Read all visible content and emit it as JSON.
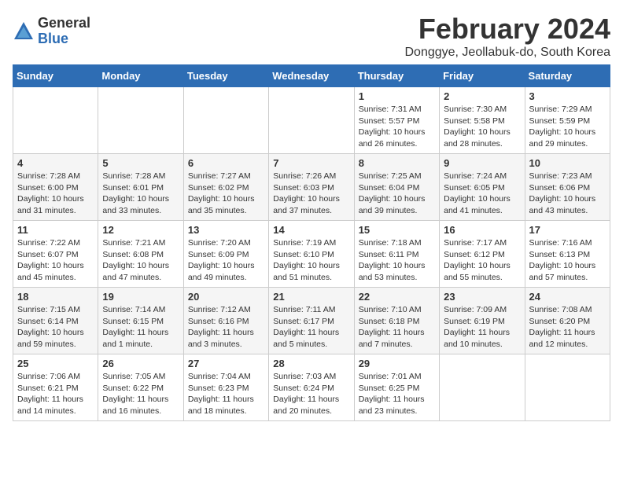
{
  "logo": {
    "general": "General",
    "blue": "Blue"
  },
  "title": "February 2024",
  "location": "Donggye, Jeollabuk-do, South Korea",
  "days_of_week": [
    "Sunday",
    "Monday",
    "Tuesday",
    "Wednesday",
    "Thursday",
    "Friday",
    "Saturday"
  ],
  "weeks": [
    [
      {
        "day": "",
        "info": ""
      },
      {
        "day": "",
        "info": ""
      },
      {
        "day": "",
        "info": ""
      },
      {
        "day": "",
        "info": ""
      },
      {
        "day": "1",
        "info": "Sunrise: 7:31 AM\nSunset: 5:57 PM\nDaylight: 10 hours\nand 26 minutes."
      },
      {
        "day": "2",
        "info": "Sunrise: 7:30 AM\nSunset: 5:58 PM\nDaylight: 10 hours\nand 28 minutes."
      },
      {
        "day": "3",
        "info": "Sunrise: 7:29 AM\nSunset: 5:59 PM\nDaylight: 10 hours\nand 29 minutes."
      }
    ],
    [
      {
        "day": "4",
        "info": "Sunrise: 7:28 AM\nSunset: 6:00 PM\nDaylight: 10 hours\nand 31 minutes."
      },
      {
        "day": "5",
        "info": "Sunrise: 7:28 AM\nSunset: 6:01 PM\nDaylight: 10 hours\nand 33 minutes."
      },
      {
        "day": "6",
        "info": "Sunrise: 7:27 AM\nSunset: 6:02 PM\nDaylight: 10 hours\nand 35 minutes."
      },
      {
        "day": "7",
        "info": "Sunrise: 7:26 AM\nSunset: 6:03 PM\nDaylight: 10 hours\nand 37 minutes."
      },
      {
        "day": "8",
        "info": "Sunrise: 7:25 AM\nSunset: 6:04 PM\nDaylight: 10 hours\nand 39 minutes."
      },
      {
        "day": "9",
        "info": "Sunrise: 7:24 AM\nSunset: 6:05 PM\nDaylight: 10 hours\nand 41 minutes."
      },
      {
        "day": "10",
        "info": "Sunrise: 7:23 AM\nSunset: 6:06 PM\nDaylight: 10 hours\nand 43 minutes."
      }
    ],
    [
      {
        "day": "11",
        "info": "Sunrise: 7:22 AM\nSunset: 6:07 PM\nDaylight: 10 hours\nand 45 minutes."
      },
      {
        "day": "12",
        "info": "Sunrise: 7:21 AM\nSunset: 6:08 PM\nDaylight: 10 hours\nand 47 minutes."
      },
      {
        "day": "13",
        "info": "Sunrise: 7:20 AM\nSunset: 6:09 PM\nDaylight: 10 hours\nand 49 minutes."
      },
      {
        "day": "14",
        "info": "Sunrise: 7:19 AM\nSunset: 6:10 PM\nDaylight: 10 hours\nand 51 minutes."
      },
      {
        "day": "15",
        "info": "Sunrise: 7:18 AM\nSunset: 6:11 PM\nDaylight: 10 hours\nand 53 minutes."
      },
      {
        "day": "16",
        "info": "Sunrise: 7:17 AM\nSunset: 6:12 PM\nDaylight: 10 hours\nand 55 minutes."
      },
      {
        "day": "17",
        "info": "Sunrise: 7:16 AM\nSunset: 6:13 PM\nDaylight: 10 hours\nand 57 minutes."
      }
    ],
    [
      {
        "day": "18",
        "info": "Sunrise: 7:15 AM\nSunset: 6:14 PM\nDaylight: 10 hours\nand 59 minutes."
      },
      {
        "day": "19",
        "info": "Sunrise: 7:14 AM\nSunset: 6:15 PM\nDaylight: 11 hours\nand 1 minute."
      },
      {
        "day": "20",
        "info": "Sunrise: 7:12 AM\nSunset: 6:16 PM\nDaylight: 11 hours\nand 3 minutes."
      },
      {
        "day": "21",
        "info": "Sunrise: 7:11 AM\nSunset: 6:17 PM\nDaylight: 11 hours\nand 5 minutes."
      },
      {
        "day": "22",
        "info": "Sunrise: 7:10 AM\nSunset: 6:18 PM\nDaylight: 11 hours\nand 7 minutes."
      },
      {
        "day": "23",
        "info": "Sunrise: 7:09 AM\nSunset: 6:19 PM\nDaylight: 11 hours\nand 10 minutes."
      },
      {
        "day": "24",
        "info": "Sunrise: 7:08 AM\nSunset: 6:20 PM\nDaylight: 11 hours\nand 12 minutes."
      }
    ],
    [
      {
        "day": "25",
        "info": "Sunrise: 7:06 AM\nSunset: 6:21 PM\nDaylight: 11 hours\nand 14 minutes."
      },
      {
        "day": "26",
        "info": "Sunrise: 7:05 AM\nSunset: 6:22 PM\nDaylight: 11 hours\nand 16 minutes."
      },
      {
        "day": "27",
        "info": "Sunrise: 7:04 AM\nSunset: 6:23 PM\nDaylight: 11 hours\nand 18 minutes."
      },
      {
        "day": "28",
        "info": "Sunrise: 7:03 AM\nSunset: 6:24 PM\nDaylight: 11 hours\nand 20 minutes."
      },
      {
        "day": "29",
        "info": "Sunrise: 7:01 AM\nSunset: 6:25 PM\nDaylight: 11 hours\nand 23 minutes."
      },
      {
        "day": "",
        "info": ""
      },
      {
        "day": "",
        "info": ""
      }
    ]
  ]
}
